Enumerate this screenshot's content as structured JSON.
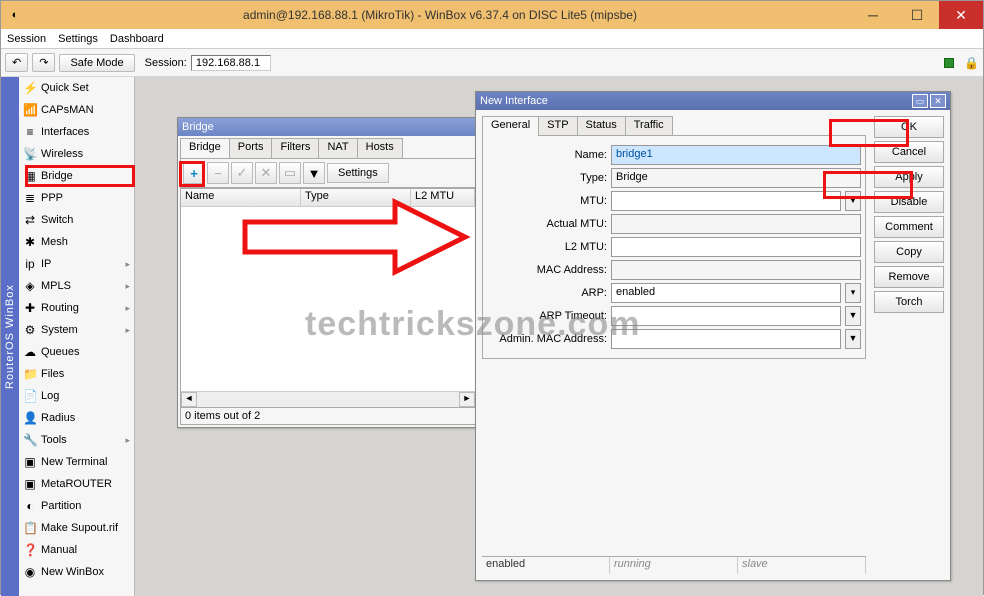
{
  "window": {
    "title": "admin@192.168.88.1 (MikroTik) - WinBox v6.37.4 on DISC Lite5 (mipsbe)"
  },
  "menubar": [
    "Session",
    "Settings",
    "Dashboard"
  ],
  "toolbar": {
    "undo": "↶",
    "redo": "↷",
    "safe": "Safe Mode",
    "sessLabel": "Session:",
    "sessValue": "192.168.88.1"
  },
  "sidebar_label": "RouterOS  WinBox",
  "sidebar": [
    {
      "ic": "⚡",
      "label": "Quick Set"
    },
    {
      "ic": "📶",
      "label": "CAPsMAN"
    },
    {
      "ic": "≡",
      "label": "Interfaces"
    },
    {
      "ic": "📡",
      "label": "Wireless"
    },
    {
      "ic": "▦",
      "label": "Bridge"
    },
    {
      "ic": "≣",
      "label": "PPP"
    },
    {
      "ic": "⇄",
      "label": "Switch"
    },
    {
      "ic": "✱",
      "label": "Mesh"
    },
    {
      "ic": "ip",
      "label": "IP",
      "sub": true
    },
    {
      "ic": "◈",
      "label": "MPLS",
      "sub": true
    },
    {
      "ic": "✚",
      "label": "Routing",
      "sub": true
    },
    {
      "ic": "⚙",
      "label": "System",
      "sub": true
    },
    {
      "ic": "☁",
      "label": "Queues"
    },
    {
      "ic": "📁",
      "label": "Files"
    },
    {
      "ic": "📄",
      "label": "Log"
    },
    {
      "ic": "👤",
      "label": "Radius"
    },
    {
      "ic": "🔧",
      "label": "Tools",
      "sub": true
    },
    {
      "ic": "▣",
      "label": "New Terminal"
    },
    {
      "ic": "▣",
      "label": "MetaROUTER"
    },
    {
      "ic": "◐",
      "label": "Partition"
    },
    {
      "ic": "📋",
      "label": "Make Supout.rif"
    },
    {
      "ic": "❓",
      "label": "Manual"
    },
    {
      "ic": "◉",
      "label": "New WinBox"
    }
  ],
  "bridge": {
    "title": "Bridge",
    "tabs": [
      "Bridge",
      "Ports",
      "Filters",
      "NAT",
      "Hosts"
    ],
    "tool_add": "+",
    "tool_remove": "−",
    "tool_ok": "✓",
    "tool_x": "✕",
    "tool_note": "▭",
    "tool_filter": "▾",
    "settings": "Settings",
    "cols": [
      "Name",
      "Type",
      "L2 MTU"
    ],
    "footer": "0 items out of 2"
  },
  "ni": {
    "title": "New Interface",
    "tabs": [
      "General",
      "STP",
      "Status",
      "Traffic"
    ],
    "fields": {
      "name_l": "Name:",
      "name_v": "bridge1",
      "type_l": "Type:",
      "type_v": "Bridge",
      "mtu_l": "MTU:",
      "mtu_v": "",
      "amtu_l": "Actual MTU:",
      "amtu_v": "",
      "l2_l": "L2 MTU:",
      "l2_v": "",
      "mac_l": "MAC Address:",
      "mac_v": "",
      "arp_l": "ARP:",
      "arp_v": "enabled",
      "arpt_l": "ARP Timeout:",
      "arpt_v": "",
      "amac_l": "Admin. MAC Address:",
      "amac_v": ""
    },
    "actions": [
      "OK",
      "Cancel",
      "Apply",
      "Disable",
      "Comment",
      "Copy",
      "Remove",
      "Torch"
    ],
    "status": [
      "enabled",
      "running",
      "slave"
    ]
  },
  "watermark": "techtrickszone.com"
}
